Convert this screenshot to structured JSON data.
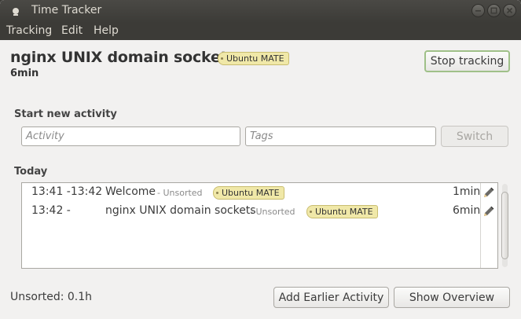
{
  "window": {
    "title": "Time Tracker"
  },
  "menubar": {
    "items": [
      "Tracking",
      "Edit",
      "Help"
    ]
  },
  "current": {
    "activity": "nginx UNIX domain sockets",
    "tag": "Ubuntu MATE",
    "duration": "6min",
    "stop_label": "Stop tracking"
  },
  "new_activity": {
    "heading": "Start new activity",
    "activity_placeholder": "Activity",
    "tags_placeholder": "Tags",
    "switch_label": "Switch"
  },
  "today": {
    "heading": "Today",
    "rows": [
      {
        "time": "13:41 -13:42",
        "name": "Welcome",
        "category": " - Unsorted",
        "tag": "Ubuntu MATE",
        "duration": "1min"
      },
      {
        "time": "13:42 -",
        "name": "nginx UNIX domain sockets",
        "category": " - Unsorted",
        "tag": "Ubuntu MATE",
        "duration": "6min"
      }
    ]
  },
  "footer": {
    "status": "Unsorted: 0.1h",
    "add_earlier_label": "Add Earlier Activity",
    "overview_label": "Show Overview"
  },
  "colors": {
    "titlebar": "#3c3b37",
    "window_bg": "#f2f1f0",
    "tag_bg": "#f0e8a8",
    "focus_border": "#9fc088"
  },
  "icons": [
    "app-icon",
    "minimize-icon",
    "maximize-icon",
    "close-icon",
    "pencil-icon"
  ]
}
